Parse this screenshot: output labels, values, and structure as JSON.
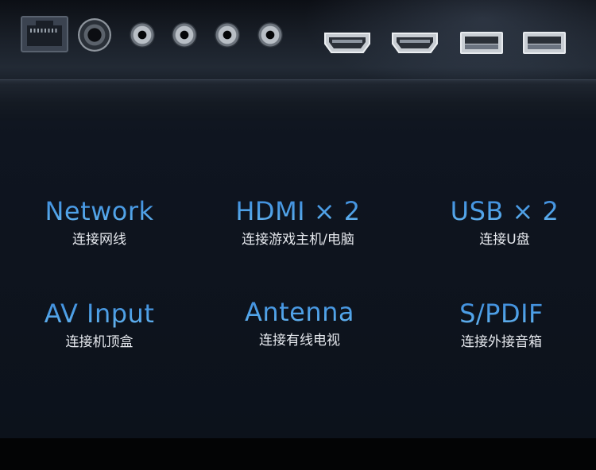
{
  "ports_panel": {
    "ports": [
      {
        "icon": "ethernet-port-icon"
      },
      {
        "icon": "coax-port-icon"
      },
      {
        "icon": "av-port-icon"
      },
      {
        "icon": "av-port-icon"
      },
      {
        "icon": "av-port-icon"
      },
      {
        "icon": "av-port-icon"
      },
      {
        "icon": "hdmi-port-icon"
      },
      {
        "icon": "hdmi-port-icon"
      },
      {
        "icon": "usb-port-icon"
      },
      {
        "icon": "usb-port-icon"
      }
    ]
  },
  "features": [
    {
      "title": "Network",
      "subtitle": "连接网线"
    },
    {
      "title": "HDMI × 2",
      "subtitle": "连接游戏主机/电脑"
    },
    {
      "title": "USB × 2",
      "subtitle": "连接U盘"
    },
    {
      "title": "AV Input",
      "subtitle": "连接机顶盒"
    },
    {
      "title": "Antenna",
      "subtitle": "连接有线电视"
    },
    {
      "title": "S/PDIF",
      "subtitle": "连接外接音箱"
    }
  ],
  "colors": {
    "accent_blue": "#4fa2e8",
    "background": "#0f1520",
    "subtitle_text": "#e6e9ee"
  }
}
